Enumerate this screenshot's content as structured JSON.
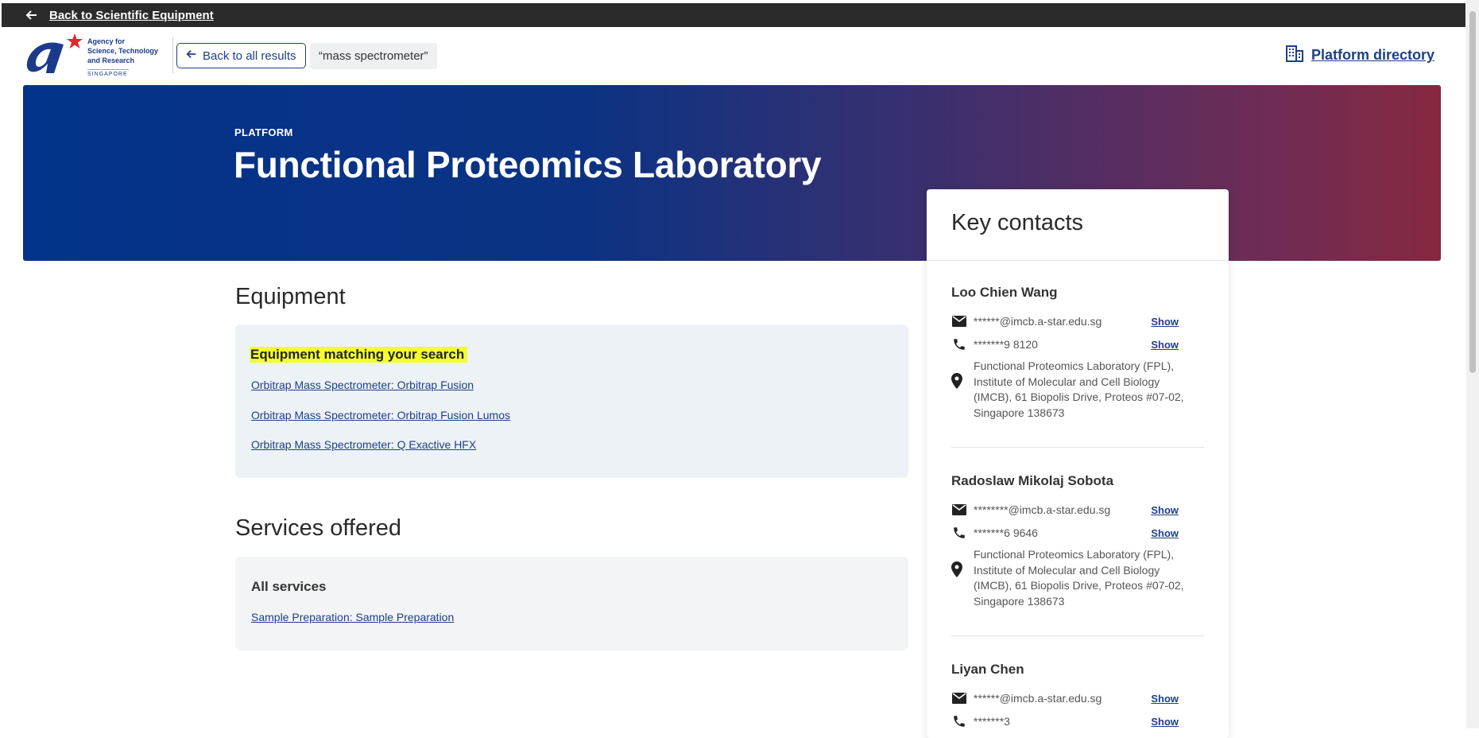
{
  "topbar": {
    "back_label": "Back to Scientific Equipment"
  },
  "logo": {
    "tagline": "Agency for Science, Technology and Research",
    "tagline_l1": "Agency for",
    "tagline_l2": "Science, Technology",
    "tagline_l3": "and Research",
    "country": "SINGAPORE"
  },
  "header": {
    "back_results_label": "Back to all results",
    "search_chip": "“mass spectrometer”",
    "directory_label": "Platform directory"
  },
  "hero": {
    "kicker": "PLATFORM",
    "title": "Functional Proteomics Laboratory"
  },
  "equipment": {
    "heading": "Equipment",
    "match_heading": "Equipment matching your search",
    "items": [
      "Orbitrap Mass Spectrometer: Orbitrap Fusion",
      "Orbitrap Mass Spectrometer: Orbitrap Fusion Lumos",
      "Orbitrap Mass Spectrometer: Q Exactive HFX"
    ]
  },
  "services": {
    "heading": "Services offered",
    "subheading": "All services",
    "items": [
      "Sample Preparation: Sample Preparation"
    ]
  },
  "contacts": {
    "heading": "Key contacts",
    "show_label": "Show",
    "people": [
      {
        "name": "Loo Chien Wang",
        "email": "******@imcb.a-star.edu.sg",
        "phone": "*******9 8120",
        "address": "Functional Proteomics Laboratory (FPL), Institute of Molecular and Cell Biology (IMCB), 61 Biopolis Drive, Proteos #07-02, Singapore 138673"
      },
      {
        "name": "Radoslaw Mikolaj Sobota",
        "email": "********@imcb.a-star.edu.sg",
        "phone": "*******6 9646",
        "address": "Functional Proteomics Laboratory (FPL), Institute of Molecular and Cell Biology (IMCB), 61 Biopolis Drive, Proteos #07-02, Singapore 138673"
      },
      {
        "name": "Liyan Chen",
        "email": "******@imcb.a-star.edu.sg",
        "phone": "*******3"
      }
    ]
  },
  "colors": {
    "brand": "#1e3f87",
    "highlight": "#f3ff2e",
    "hero_start": "#03338a",
    "hero_end": "#86283f"
  },
  "icons": [
    "arrow-left-icon",
    "building-icon",
    "mail-icon",
    "phone-icon",
    "location-pin-icon"
  ]
}
